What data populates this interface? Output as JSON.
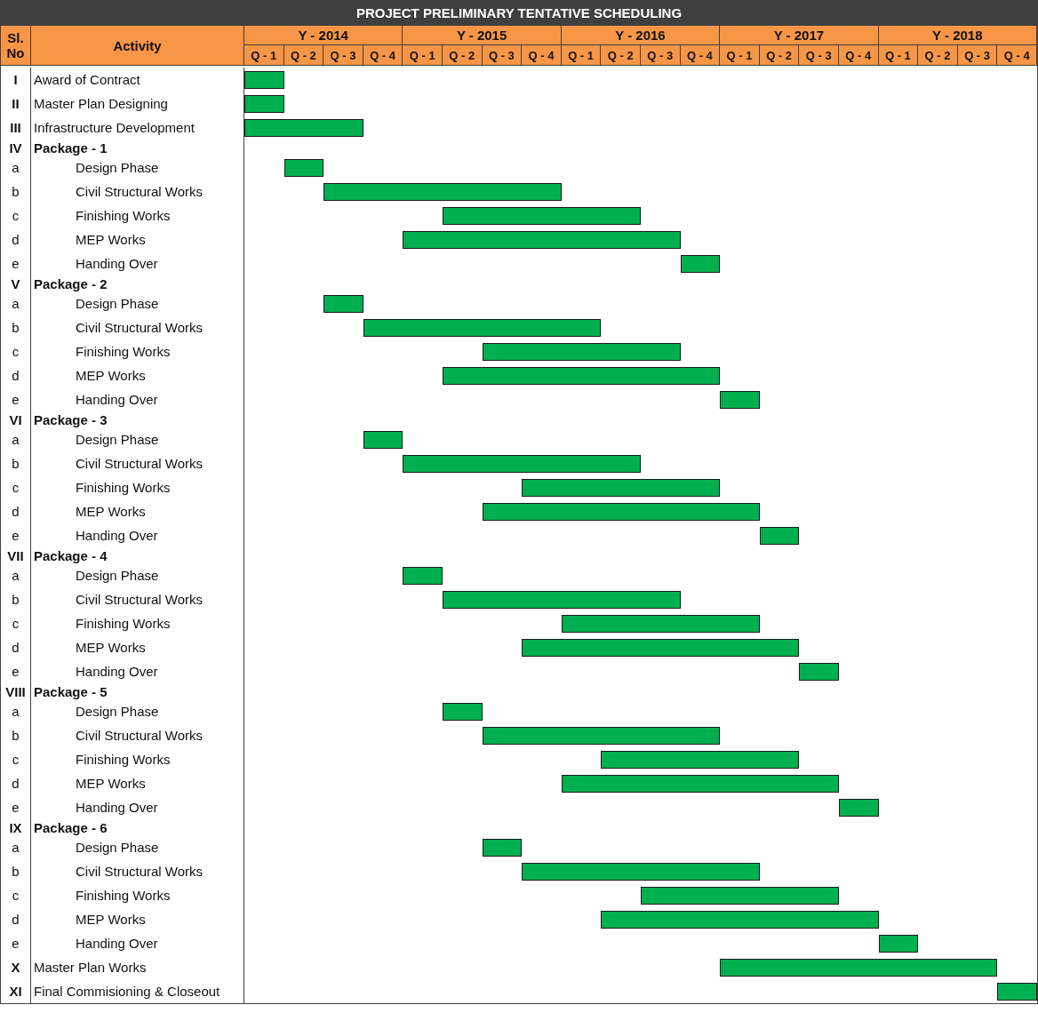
{
  "title": "PROJECT PRELIMINARY TENTATIVE SCHEDULING",
  "sl_no_header": [
    "Sl.",
    "No"
  ],
  "activity_header": "Activity",
  "years": [
    {
      "label": "Y - 2014",
      "quarters": [
        "Q - 1",
        "Q - 2",
        "Q - 3",
        "Q - 4"
      ]
    },
    {
      "label": "Y - 2015",
      "quarters": [
        "Q - 1",
        "Q - 2",
        "Q - 3",
        "Q - 4"
      ]
    },
    {
      "label": "Y - 2016",
      "quarters": [
        "Q - 1",
        "Q - 2",
        "Q - 3",
        "Q - 4"
      ]
    },
    {
      "label": "Y - 2017",
      "quarters": [
        "Q - 1",
        "Q - 2",
        "Q - 3",
        "Q - 4"
      ]
    },
    {
      "label": "Y - 2018",
      "quarters": [
        "Q - 1",
        "Q - 2",
        "Q - 3",
        "Q - 4"
      ]
    }
  ],
  "rows": [
    {
      "sl": "I",
      "activity": "Award of Contract",
      "kind": "item",
      "bar": [
        true,
        false,
        false,
        false,
        false,
        false,
        false,
        false,
        false,
        false,
        false,
        false,
        false,
        false,
        false,
        false,
        false,
        false,
        false,
        false
      ]
    },
    {
      "sl": "II",
      "activity": "Master Plan Designing",
      "kind": "item",
      "bar": [
        true,
        false,
        false,
        false,
        false,
        false,
        false,
        false,
        false,
        false,
        false,
        false,
        false,
        false,
        false,
        false,
        false,
        false,
        false,
        false
      ]
    },
    {
      "sl": "III",
      "activity": "Infrastructure Development",
      "kind": "item",
      "bar": [
        true,
        true,
        true,
        false,
        false,
        false,
        false,
        false,
        false,
        false,
        false,
        false,
        false,
        false,
        false,
        false,
        false,
        false,
        false,
        false
      ]
    },
    {
      "sl": "IV",
      "activity": "Package - 1",
      "kind": "package"
    },
    {
      "sl": "a",
      "activity": "Design Phase",
      "kind": "sub",
      "bar": [
        false,
        true,
        false,
        false,
        false,
        false,
        false,
        false,
        false,
        false,
        false,
        false,
        false,
        false,
        false,
        false,
        false,
        false,
        false,
        false
      ]
    },
    {
      "sl": "b",
      "activity": "Civil Structural Works",
      "kind": "sub",
      "bar": [
        false,
        false,
        true,
        true,
        true,
        true,
        true,
        true,
        false,
        false,
        false,
        false,
        false,
        false,
        false,
        false,
        false,
        false,
        false,
        false
      ]
    },
    {
      "sl": "c",
      "activity": "Finishing Works",
      "kind": "sub",
      "bar": [
        false,
        false,
        false,
        false,
        false,
        true,
        true,
        true,
        true,
        true,
        false,
        false,
        false,
        false,
        false,
        false,
        false,
        false,
        false,
        false
      ]
    },
    {
      "sl": "d",
      "activity": "MEP Works",
      "kind": "sub",
      "bar": [
        false,
        false,
        false,
        false,
        true,
        true,
        true,
        true,
        true,
        true,
        true,
        false,
        false,
        false,
        false,
        false,
        false,
        false,
        false,
        false
      ]
    },
    {
      "sl": "e",
      "activity": "Handing Over",
      "kind": "sub",
      "bar": [
        false,
        false,
        false,
        false,
        false,
        false,
        false,
        false,
        false,
        false,
        false,
        true,
        false,
        false,
        false,
        false,
        false,
        false,
        false,
        false
      ]
    },
    {
      "sl": "V",
      "activity": "Package - 2",
      "kind": "package"
    },
    {
      "sl": "a",
      "activity": "Design Phase",
      "kind": "sub",
      "bar": [
        false,
        false,
        true,
        false,
        false,
        false,
        false,
        false,
        false,
        false,
        false,
        false,
        false,
        false,
        false,
        false,
        false,
        false,
        false,
        false
      ]
    },
    {
      "sl": "b",
      "activity": "Civil Structural Works",
      "kind": "sub",
      "bar": [
        false,
        false,
        false,
        true,
        true,
        true,
        true,
        true,
        true,
        false,
        false,
        false,
        false,
        false,
        false,
        false,
        false,
        false,
        false,
        false
      ]
    },
    {
      "sl": "c",
      "activity": "Finishing Works",
      "kind": "sub",
      "bar": [
        false,
        false,
        false,
        false,
        false,
        false,
        true,
        true,
        true,
        true,
        true,
        false,
        false,
        false,
        false,
        false,
        false,
        false,
        false,
        false
      ]
    },
    {
      "sl": "d",
      "activity": "MEP Works",
      "kind": "sub",
      "bar": [
        false,
        false,
        false,
        false,
        false,
        true,
        true,
        true,
        true,
        true,
        true,
        true,
        false,
        false,
        false,
        false,
        false,
        false,
        false,
        false
      ]
    },
    {
      "sl": "e",
      "activity": "Handing Over",
      "kind": "sub",
      "bar": [
        false,
        false,
        false,
        false,
        false,
        false,
        false,
        false,
        false,
        false,
        false,
        false,
        true,
        false,
        false,
        false,
        false,
        false,
        false,
        false
      ]
    },
    {
      "sl": "VI",
      "activity": "Package - 3",
      "kind": "package"
    },
    {
      "sl": "a",
      "activity": "Design Phase",
      "kind": "sub",
      "bar": [
        false,
        false,
        false,
        true,
        false,
        false,
        false,
        false,
        false,
        false,
        false,
        false,
        false,
        false,
        false,
        false,
        false,
        false,
        false,
        false
      ]
    },
    {
      "sl": "b",
      "activity": "Civil Structural Works",
      "kind": "sub",
      "bar": [
        false,
        false,
        false,
        false,
        true,
        true,
        true,
        true,
        true,
        true,
        false,
        false,
        false,
        false,
        false,
        false,
        false,
        false,
        false,
        false
      ]
    },
    {
      "sl": "c",
      "activity": "Finishing Works",
      "kind": "sub",
      "bar": [
        false,
        false,
        false,
        false,
        false,
        false,
        false,
        true,
        true,
        true,
        true,
        true,
        false,
        false,
        false,
        false,
        false,
        false,
        false,
        false
      ]
    },
    {
      "sl": "d",
      "activity": "MEP Works",
      "kind": "sub",
      "bar": [
        false,
        false,
        false,
        false,
        false,
        false,
        true,
        true,
        true,
        true,
        true,
        true,
        true,
        false,
        false,
        false,
        false,
        false,
        false,
        false
      ]
    },
    {
      "sl": "e",
      "activity": "Handing Over",
      "kind": "sub",
      "bar": [
        false,
        false,
        false,
        false,
        false,
        false,
        false,
        false,
        false,
        false,
        false,
        false,
        false,
        true,
        false,
        false,
        false,
        false,
        false,
        false
      ]
    },
    {
      "sl": "VII",
      "activity": "Package - 4",
      "kind": "package"
    },
    {
      "sl": "a",
      "activity": "Design Phase",
      "kind": "sub",
      "bar": [
        false,
        false,
        false,
        false,
        true,
        false,
        false,
        false,
        false,
        false,
        false,
        false,
        false,
        false,
        false,
        false,
        false,
        false,
        false,
        false
      ]
    },
    {
      "sl": "b",
      "activity": "Civil Structural Works",
      "kind": "sub",
      "bar": [
        false,
        false,
        false,
        false,
        false,
        true,
        true,
        true,
        true,
        true,
        true,
        false,
        false,
        false,
        false,
        false,
        false,
        false,
        false,
        false
      ]
    },
    {
      "sl": "c",
      "activity": "Finishing Works",
      "kind": "sub",
      "bar": [
        false,
        false,
        false,
        false,
        false,
        false,
        false,
        false,
        true,
        true,
        true,
        true,
        true,
        false,
        false,
        false,
        false,
        false,
        false,
        false
      ]
    },
    {
      "sl": "d",
      "activity": "MEP Works",
      "kind": "sub",
      "bar": [
        false,
        false,
        false,
        false,
        false,
        false,
        false,
        true,
        true,
        true,
        true,
        true,
        true,
        true,
        false,
        false,
        false,
        false,
        false,
        false
      ]
    },
    {
      "sl": "e",
      "activity": "Handing Over",
      "kind": "sub",
      "bar": [
        false,
        false,
        false,
        false,
        false,
        false,
        false,
        false,
        false,
        false,
        false,
        false,
        false,
        false,
        true,
        false,
        false,
        false,
        false,
        false
      ]
    },
    {
      "sl": "VIII",
      "activity": "Package - 5",
      "kind": "package"
    },
    {
      "sl": "a",
      "activity": "Design Phase",
      "kind": "sub",
      "bar": [
        false,
        false,
        false,
        false,
        false,
        true,
        false,
        false,
        false,
        false,
        false,
        false,
        false,
        false,
        false,
        false,
        false,
        false,
        false,
        false
      ]
    },
    {
      "sl": "b",
      "activity": "Civil Structural Works",
      "kind": "sub",
      "bar": [
        false,
        false,
        false,
        false,
        false,
        false,
        true,
        true,
        true,
        true,
        true,
        true,
        false,
        false,
        false,
        false,
        false,
        false,
        false,
        false
      ]
    },
    {
      "sl": "c",
      "activity": "Finishing Works",
      "kind": "sub",
      "bar": [
        false,
        false,
        false,
        false,
        false,
        false,
        false,
        false,
        false,
        true,
        true,
        true,
        true,
        true,
        false,
        false,
        false,
        false,
        false,
        false
      ]
    },
    {
      "sl": "d",
      "activity": "MEP Works",
      "kind": "sub",
      "bar": [
        false,
        false,
        false,
        false,
        false,
        false,
        false,
        false,
        true,
        true,
        true,
        true,
        true,
        true,
        true,
        false,
        false,
        false,
        false,
        false
      ]
    },
    {
      "sl": "e",
      "activity": "Handing Over",
      "kind": "sub",
      "bar": [
        false,
        false,
        false,
        false,
        false,
        false,
        false,
        false,
        false,
        false,
        false,
        false,
        false,
        false,
        false,
        true,
        false,
        false,
        false,
        false
      ]
    },
    {
      "sl": "IX",
      "activity": "Package - 6",
      "kind": "package"
    },
    {
      "sl": "a",
      "activity": "Design Phase",
      "kind": "sub",
      "bar": [
        false,
        false,
        false,
        false,
        false,
        false,
        true,
        false,
        false,
        false,
        false,
        false,
        false,
        false,
        false,
        false,
        false,
        false,
        false,
        false
      ]
    },
    {
      "sl": "b",
      "activity": "Civil Structural Works",
      "kind": "sub",
      "bar": [
        false,
        false,
        false,
        false,
        false,
        false,
        false,
        true,
        true,
        true,
        true,
        true,
        true,
        false,
        false,
        false,
        false,
        false,
        false,
        false
      ]
    },
    {
      "sl": "c",
      "activity": "Finishing Works",
      "kind": "sub",
      "bar": [
        false,
        false,
        false,
        false,
        false,
        false,
        false,
        false,
        false,
        false,
        true,
        true,
        true,
        true,
        true,
        false,
        false,
        false,
        false,
        false
      ]
    },
    {
      "sl": "d",
      "activity": "MEP Works",
      "kind": "sub",
      "bar": [
        false,
        false,
        false,
        false,
        false,
        false,
        false,
        false,
        false,
        true,
        true,
        true,
        true,
        true,
        true,
        true,
        false,
        false,
        false,
        false
      ]
    },
    {
      "sl": "e",
      "activity": "Handing Over",
      "kind": "sub",
      "bar": [
        false,
        false,
        false,
        false,
        false,
        false,
        false,
        false,
        false,
        false,
        false,
        false,
        false,
        false,
        false,
        false,
        true,
        false,
        false,
        false
      ]
    },
    {
      "sl": "X",
      "activity": "Master Plan Works",
      "kind": "item",
      "bar": [
        false,
        false,
        false,
        false,
        false,
        false,
        false,
        false,
        false,
        false,
        false,
        false,
        true,
        true,
        true,
        true,
        true,
        true,
        true,
        false
      ]
    },
    {
      "sl": "XI",
      "activity": "Final Commisioning & Closeout",
      "kind": "item",
      "bar": [
        false,
        false,
        false,
        false,
        false,
        false,
        false,
        false,
        false,
        false,
        false,
        false,
        false,
        false,
        false,
        false,
        false,
        false,
        false,
        true
      ]
    }
  ]
}
